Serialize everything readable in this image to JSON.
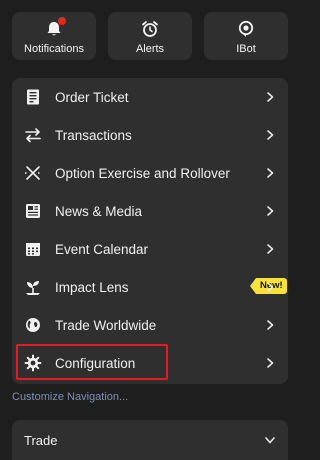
{
  "quick_tiles": [
    {
      "label": "Notifications",
      "icon": "bell-icon",
      "has_badge": true
    },
    {
      "label": "Alerts",
      "icon": "alarm-clock-icon"
    },
    {
      "label": "IBot",
      "icon": "ibot-icon"
    }
  ],
  "menu": {
    "items": [
      {
        "label": "Order Ticket",
        "icon": "order-ticket-icon"
      },
      {
        "label": "Transactions",
        "icon": "transactions-icon"
      },
      {
        "label": "Option Exercise and Rollover",
        "icon": "option-exercise-icon"
      },
      {
        "label": "News & Media",
        "icon": "news-icon"
      },
      {
        "label": "Event Calendar",
        "icon": "calendar-icon"
      },
      {
        "label": "Impact Lens",
        "icon": "impact-lens-icon",
        "badge": "New!"
      },
      {
        "label": "Trade Worldwide",
        "icon": "globe-icon"
      },
      {
        "label": "Configuration",
        "icon": "gear-icon",
        "highlighted": true
      }
    ]
  },
  "customize_link": "Customize Navigation...",
  "trade_section": {
    "label": "Trade"
  },
  "colors": {
    "background": "#1e1e1e",
    "card": "#2f2f30",
    "highlight_border": "#e31b23",
    "badge_yellow": "#f6e23a",
    "link": "#7b90b9",
    "notification_dot": "#e8271e"
  }
}
